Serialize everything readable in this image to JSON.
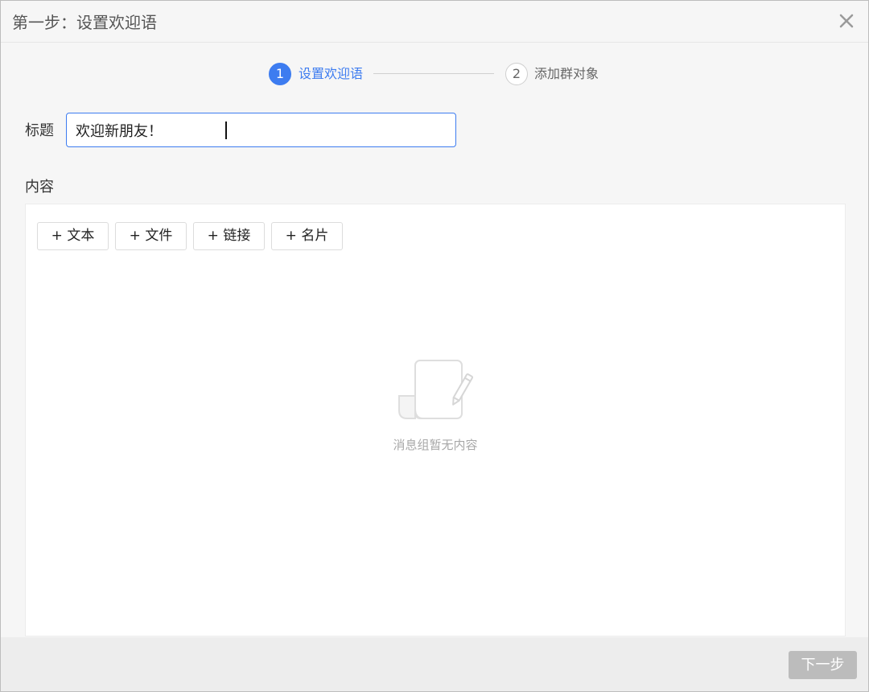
{
  "dialog": {
    "title": "第一步：设置欢迎语"
  },
  "steps": [
    {
      "number": "1",
      "label": "设置欢迎语",
      "state": "active"
    },
    {
      "number": "2",
      "label": "添加群对象",
      "state": "inactive"
    }
  ],
  "form": {
    "title_label": "标题",
    "title_value": "欢迎新朋友！",
    "content_label": "内容"
  },
  "content": {
    "buttons": [
      {
        "label": "+ 文本"
      },
      {
        "label": "+ 文件"
      },
      {
        "label": "+ 链接"
      },
      {
        "label": "+ 名片"
      }
    ],
    "empty_text": "消息组暂无内容"
  },
  "footer": {
    "next_label": "下一步"
  },
  "colors": {
    "accent": "#3d7cf0",
    "disabled_button": "#bcbcbc"
  }
}
